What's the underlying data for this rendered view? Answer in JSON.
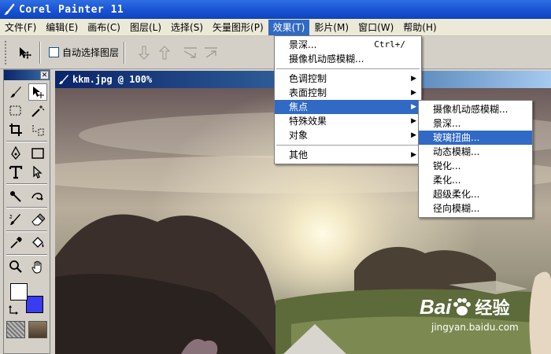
{
  "app": {
    "title": "Corel Painter 11"
  },
  "menubar": [
    {
      "label": "文件(F)"
    },
    {
      "label": "编辑(E)"
    },
    {
      "label": "画布(C)"
    },
    {
      "label": "图层(L)"
    },
    {
      "label": "选择(S)"
    },
    {
      "label": "矢量图形(P)"
    },
    {
      "label": "效果(T)"
    },
    {
      "label": "影片(M)"
    },
    {
      "label": "窗口(W)"
    },
    {
      "label": "帮助(H)"
    }
  ],
  "toolbar": {
    "auto_select_label": "自动选择图层"
  },
  "document": {
    "title": "kkm.jpg @ 100%"
  },
  "effects_menu": {
    "items": [
      {
        "label": "景深...",
        "shortcut": "Ctrl+/"
      },
      {
        "label": "摄像机动感模糊..."
      },
      {
        "label": "色调控制"
      },
      {
        "label": "表面控制"
      },
      {
        "label": "焦点"
      },
      {
        "label": "特殊效果"
      },
      {
        "label": "对象"
      },
      {
        "label": "其他"
      }
    ]
  },
  "focus_submenu": {
    "items": [
      {
        "label": "摄像机动感模糊..."
      },
      {
        "label": "景深..."
      },
      {
        "label": "玻璃扭曲..."
      },
      {
        "label": "动态模糊..."
      },
      {
        "label": "锐化..."
      },
      {
        "label": "柔化..."
      },
      {
        "label": "超级柔化..."
      },
      {
        "label": "径向模糊..."
      }
    ]
  },
  "colors": {
    "menu_highlight": "#316ac5",
    "title_blue": "#1a55d6",
    "background_color": "#3a3cf0"
  },
  "watermark": {
    "brand": "Bai",
    "brand2": "经验",
    "url": "jingyan.baidu.com"
  }
}
